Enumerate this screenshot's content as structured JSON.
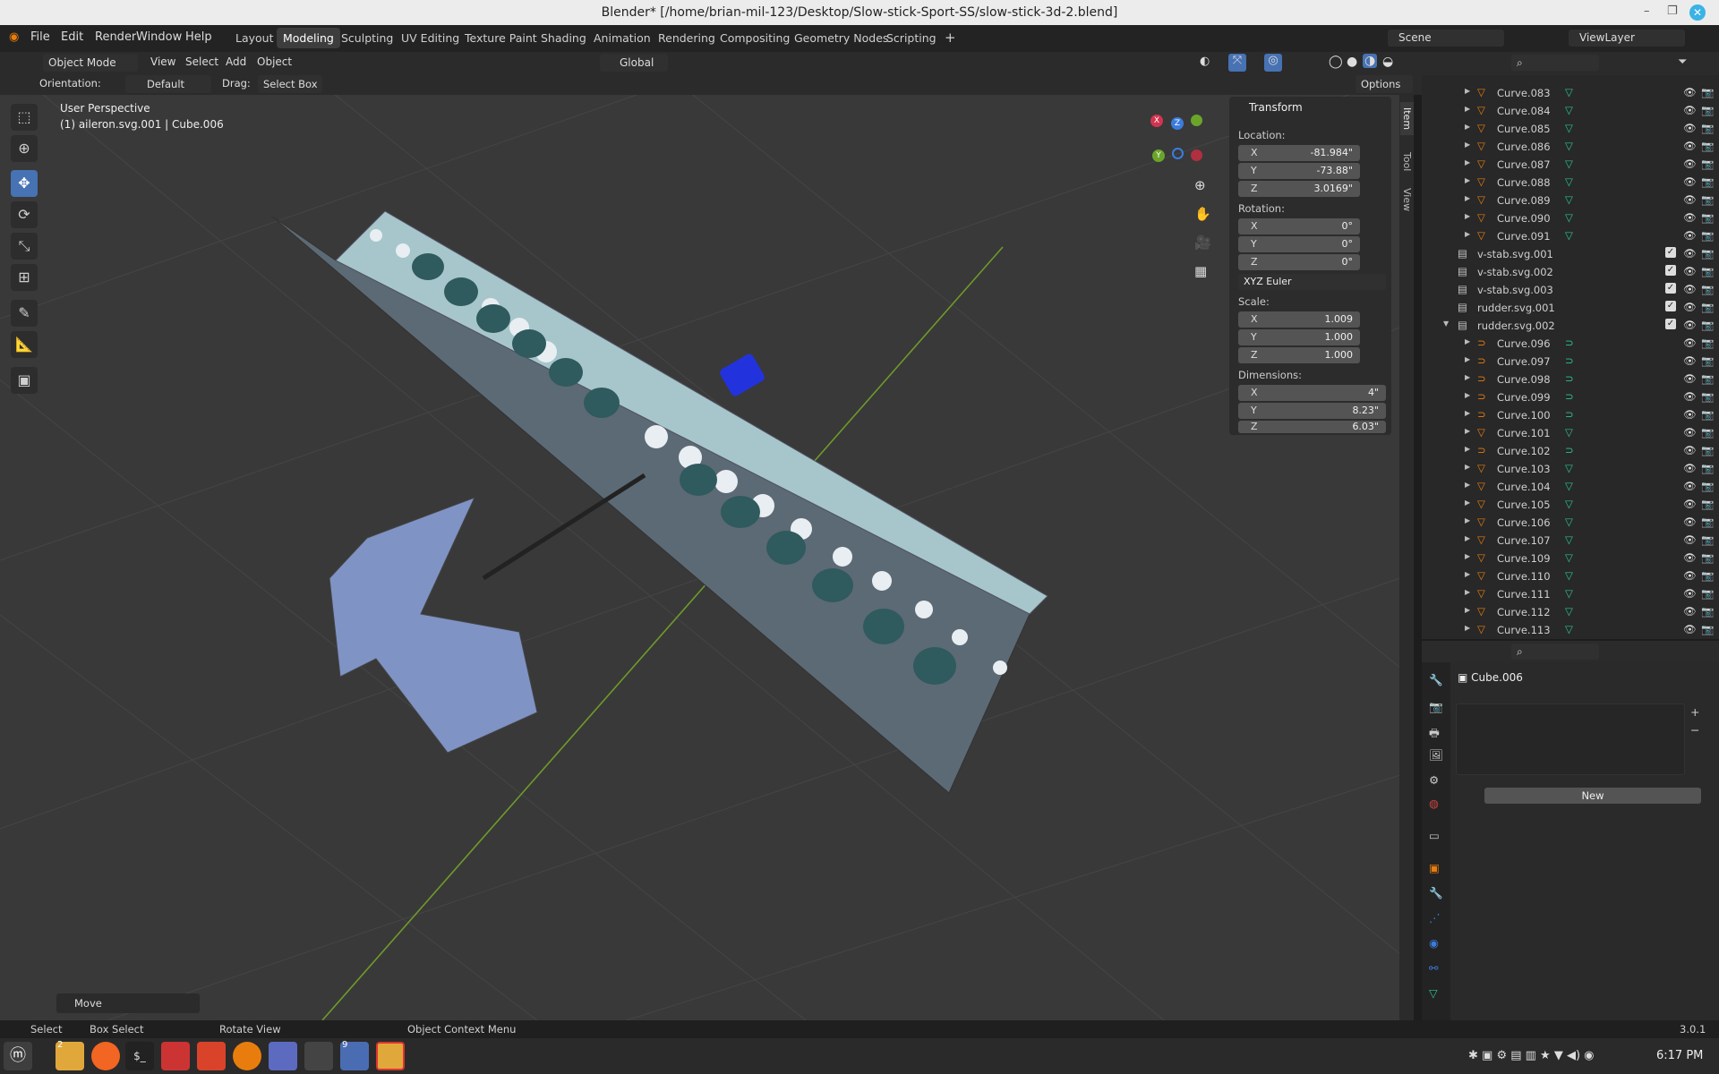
{
  "window": {
    "title": "Blender* [/home/brian-mil-123/Desktop/Slow-stick-Sport-SS/slow-stick-3d-2.blend]",
    "close": "✕",
    "min": "–",
    "max": "❐"
  },
  "menus": [
    "File",
    "Edit",
    "Render",
    "Window",
    "Help"
  ],
  "workspaces": [
    "Layout",
    "Modeling",
    "Sculpting",
    "UV Editing",
    "Texture Paint",
    "Shading",
    "Animation",
    "Rendering",
    "Compositing",
    "Geometry Nodes",
    "Scripting"
  ],
  "active_workspace": "Modeling",
  "scene": "Scene",
  "view_layer": "ViewLayer",
  "header": {
    "mode": "Object Mode",
    "view": "View",
    "select": "Select",
    "add": "Add",
    "object": "Object",
    "transform": "Global"
  },
  "subheader": {
    "orientation_label": "Orientation:",
    "orientation": "Default",
    "drag_label": "Drag:",
    "drag": "Select Box",
    "options": "Options"
  },
  "viewport": {
    "perspective": "User Perspective",
    "object_info": "(1) aileron.svg.001 | Cube.006",
    "operator": "Move"
  },
  "gizmo": {
    "x": "X",
    "y": "Y",
    "z": "Z"
  },
  "sidebar_tabs": [
    "Item",
    "Tool",
    "View"
  ],
  "transform": {
    "title": "Transform",
    "location_label": "Location:",
    "location": {
      "x": "-81.984\"",
      "y": "-73.88\"",
      "z": "3.0169\""
    },
    "rotation_label": "Rotation:",
    "rotation": {
      "x": "0°",
      "y": "0°",
      "z": "0°"
    },
    "rotation_mode": "XYZ Euler",
    "scale_label": "Scale:",
    "scale": {
      "x": "1.009",
      "y": "1.000",
      "z": "1.000"
    },
    "dimensions_label": "Dimensions:",
    "dimensions": {
      "x": "4\"",
      "y": "8.23\"",
      "z": "6.03\""
    }
  },
  "outliner": [
    {
      "name": "Curve.083",
      "kind": "curve"
    },
    {
      "name": "Curve.084",
      "kind": "curve"
    },
    {
      "name": "Curve.085",
      "kind": "curve"
    },
    {
      "name": "Curve.086",
      "kind": "curve"
    },
    {
      "name": "Curve.087",
      "kind": "curve"
    },
    {
      "name": "Curve.088",
      "kind": "curve"
    },
    {
      "name": "Curve.089",
      "kind": "curve"
    },
    {
      "name": "Curve.090",
      "kind": "curve"
    },
    {
      "name": "Curve.091",
      "kind": "curve"
    },
    {
      "name": "v-stab.svg.001",
      "kind": "collection"
    },
    {
      "name": "v-stab.svg.002",
      "kind": "collection"
    },
    {
      "name": "v-stab.svg.003",
      "kind": "collection"
    },
    {
      "name": "rudder.svg.001",
      "kind": "collection"
    },
    {
      "name": "rudder.svg.002",
      "kind": "collection-open"
    },
    {
      "name": "Curve.096",
      "kind": "curve2"
    },
    {
      "name": "Curve.097",
      "kind": "curve2"
    },
    {
      "name": "Curve.098",
      "kind": "curve2"
    },
    {
      "name": "Curve.099",
      "kind": "curve2"
    },
    {
      "name": "Curve.100",
      "kind": "curve2"
    },
    {
      "name": "Curve.101",
      "kind": "curve"
    },
    {
      "name": "Curve.102",
      "kind": "curve2"
    },
    {
      "name": "Curve.103",
      "kind": "curve"
    },
    {
      "name": "Curve.104",
      "kind": "curve"
    },
    {
      "name": "Curve.105",
      "kind": "curve"
    },
    {
      "name": "Curve.106",
      "kind": "curve"
    },
    {
      "name": "Curve.107",
      "kind": "curve"
    },
    {
      "name": "Curve.109",
      "kind": "curve"
    },
    {
      "name": "Curve.110",
      "kind": "curve"
    },
    {
      "name": "Curve.111",
      "kind": "curve"
    },
    {
      "name": "Curve.112",
      "kind": "curve"
    },
    {
      "name": "Curve.113",
      "kind": "curve"
    }
  ],
  "properties": {
    "object": "Cube.006",
    "new_label": "New"
  },
  "status": {
    "select": "Select",
    "box_select": "Box Select",
    "rotate_view": "Rotate View",
    "context_menu": "Object Context Menu",
    "version": "3.0.1"
  },
  "taskbar": {
    "time": "6:17 PM",
    "badge1": "2",
    "badge2": "9"
  }
}
